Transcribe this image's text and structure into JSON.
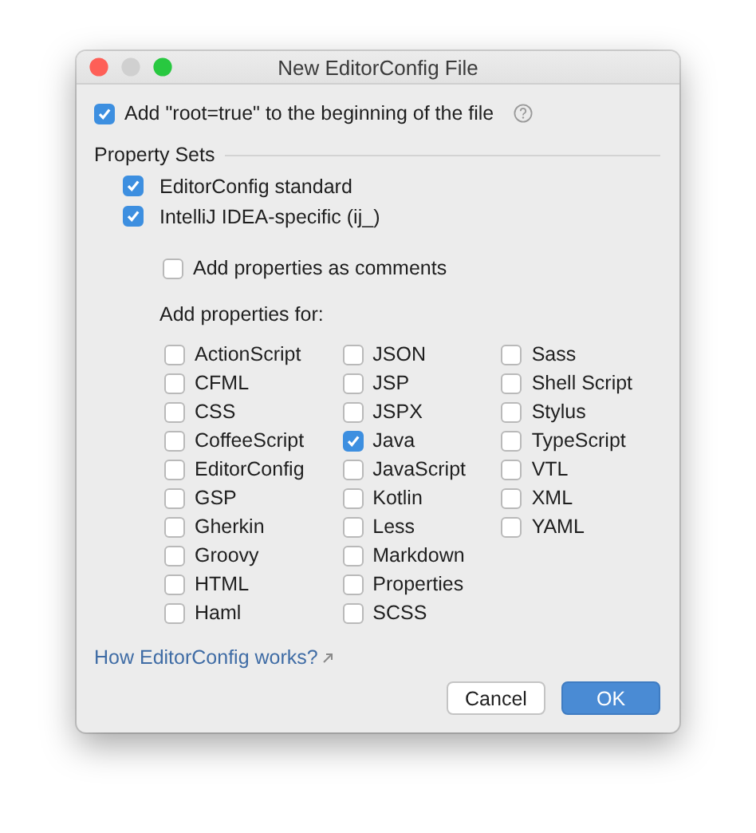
{
  "window": {
    "title": "New EditorConfig File"
  },
  "root_option": {
    "label": "Add \"root=true\" to the beginning of the file",
    "checked": true
  },
  "property_sets": {
    "title": "Property Sets",
    "options": [
      {
        "label": "EditorConfig standard",
        "checked": true
      },
      {
        "label": "IntelliJ IDEA-specific (ij_)",
        "checked": true
      }
    ],
    "comments_option": {
      "label": "Add properties as comments",
      "checked": false
    }
  },
  "add_properties": {
    "title": "Add properties for:",
    "columns": [
      [
        {
          "label": "ActionScript",
          "checked": false
        },
        {
          "label": "CFML",
          "checked": false
        },
        {
          "label": "CSS",
          "checked": false
        },
        {
          "label": "CoffeeScript",
          "checked": false
        },
        {
          "label": "EditorConfig",
          "checked": false
        },
        {
          "label": "GSP",
          "checked": false
        },
        {
          "label": "Gherkin",
          "checked": false
        },
        {
          "label": "Groovy",
          "checked": false
        },
        {
          "label": "HTML",
          "checked": false
        },
        {
          "label": "Haml",
          "checked": false
        }
      ],
      [
        {
          "label": "JSON",
          "checked": false
        },
        {
          "label": "JSP",
          "checked": false
        },
        {
          "label": "JSPX",
          "checked": false
        },
        {
          "label": "Java",
          "checked": true
        },
        {
          "label": "JavaScript",
          "checked": false
        },
        {
          "label": "Kotlin",
          "checked": false
        },
        {
          "label": "Less",
          "checked": false
        },
        {
          "label": "Markdown",
          "checked": false
        },
        {
          "label": "Properties",
          "checked": false
        },
        {
          "label": "SCSS",
          "checked": false
        }
      ],
      [
        {
          "label": "Sass",
          "checked": false
        },
        {
          "label": "Shell Script",
          "checked": false
        },
        {
          "label": "Stylus",
          "checked": false
        },
        {
          "label": "TypeScript",
          "checked": false
        },
        {
          "label": "VTL",
          "checked": false
        },
        {
          "label": "XML",
          "checked": false
        },
        {
          "label": "YAML",
          "checked": false
        }
      ]
    ]
  },
  "help_link": "How EditorConfig works?",
  "buttons": [
    {
      "label": "Cancel",
      "kind": "secondary"
    },
    {
      "label": "OK",
      "kind": "primary"
    }
  ]
}
